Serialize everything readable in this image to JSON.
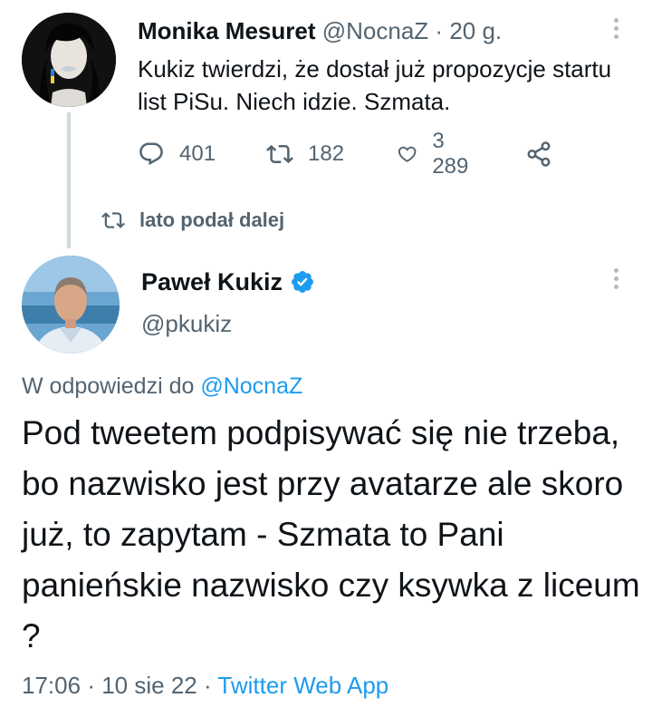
{
  "parent_tweet": {
    "author_name": "Monika Mesuret",
    "handle": "@NocnaZ",
    "separator": "·",
    "time": "20 g.",
    "text": "Kukiz twierdzi, że dostał już propozycje startu list PiSu. Niech idzie. Szmata.",
    "replies": "401",
    "retweets": "182",
    "likes": "3 289",
    "icons": [
      "reply-icon",
      "retweet-icon",
      "like-icon",
      "share-icon",
      "more-icon"
    ]
  },
  "retweet_banner": {
    "label": "lato podał dalej",
    "icon": "retweet-icon"
  },
  "main_tweet": {
    "author_name": "Paweł Kukiz",
    "handle": "@pkukiz",
    "verified": true,
    "reply_prefix": "W odpowiedzi do",
    "reply_handle": "@NocnaZ",
    "text": "Pod tweetem podpisywać się nie trzeba, bo nazwisko jest przy avatarze ale skoro już, to zapytam - Szmata to Pani panieńskie nazwisko czy ksywka z liceum ?",
    "time": "17:06",
    "separator": "·",
    "date": "10 sie 22",
    "source": "Twitter Web App"
  },
  "colors": {
    "text": "#0f1419",
    "secondary": "#536471",
    "link": "#1d9bf0",
    "thread_line": "#cfd9de"
  }
}
